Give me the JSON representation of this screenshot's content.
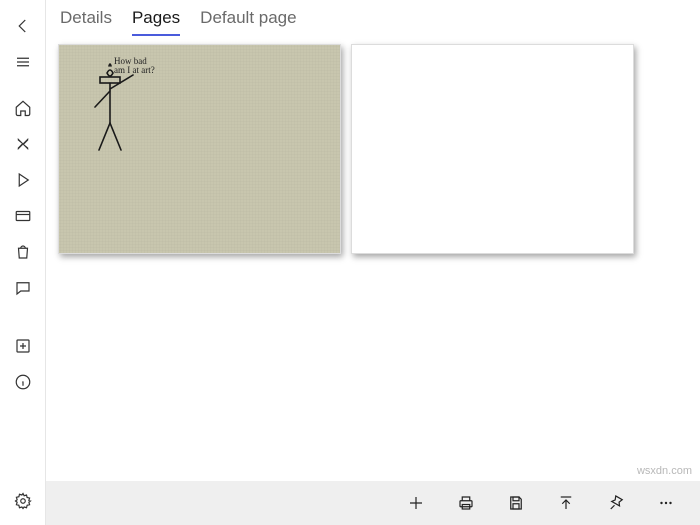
{
  "tabs": {
    "details": "Details",
    "pages": "Pages",
    "default_page": "Default page",
    "active": "pages"
  },
  "sidebar": {
    "items": [
      "back",
      "menu",
      "home",
      "cross",
      "play",
      "card",
      "bag",
      "chat"
    ],
    "section2": [
      "add-box",
      "info"
    ],
    "bottom": [
      "settings"
    ]
  },
  "pages": [
    {
      "id": 0,
      "type": "sketch",
      "caption_line1": "How bad",
      "caption_line2": "am I at art?"
    },
    {
      "id": 1,
      "type": "blank"
    }
  ],
  "toolbar": {
    "actions": [
      "add",
      "print",
      "save",
      "publish",
      "pin",
      "more"
    ]
  },
  "watermark": "wsxdn.com"
}
